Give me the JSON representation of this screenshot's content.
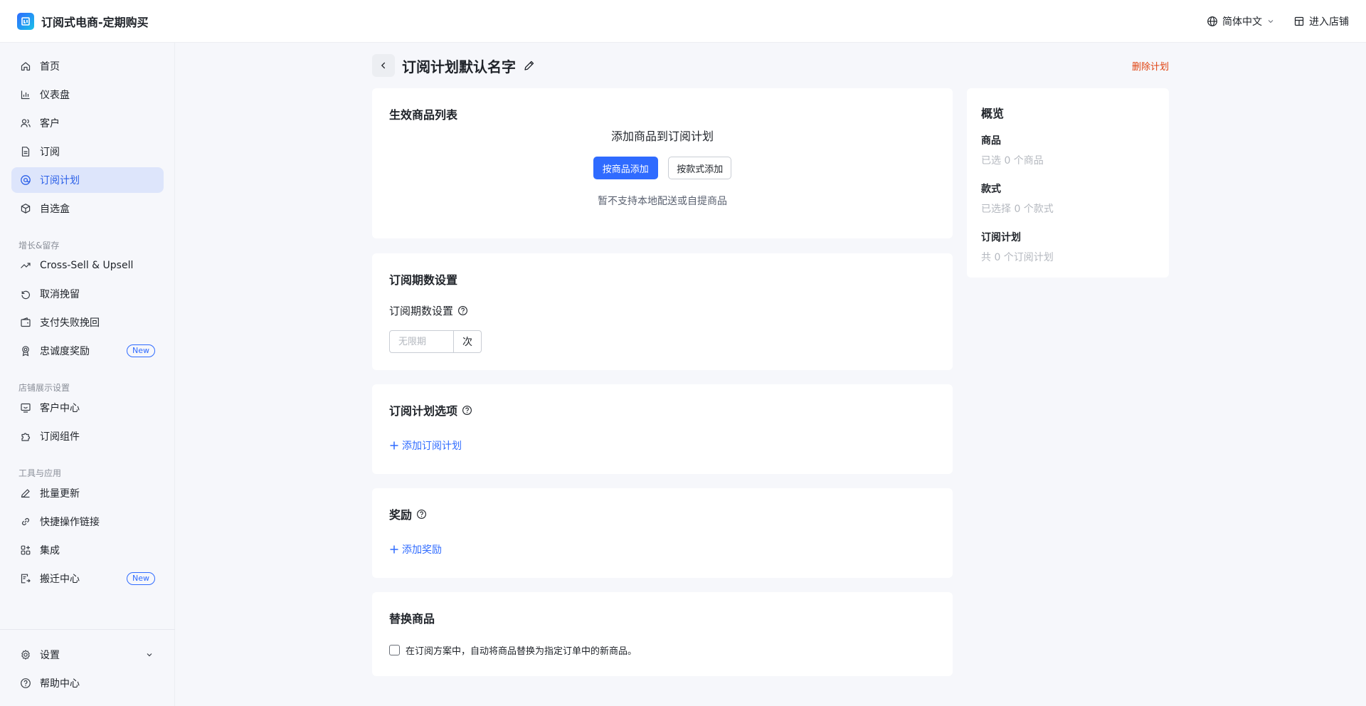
{
  "app": {
    "title": "订阅式电商-定期购买"
  },
  "topbar": {
    "language": "简体中文",
    "enter_store": "进入店铺"
  },
  "sidebar": {
    "items": [
      {
        "label": "首页",
        "icon": "home-icon"
      },
      {
        "label": "仪表盘",
        "icon": "bar-chart-icon"
      },
      {
        "label": "客户",
        "icon": "users-icon"
      },
      {
        "label": "订阅",
        "icon": "document-icon"
      },
      {
        "label": "订阅计划",
        "icon": "plan-icon",
        "active": true
      },
      {
        "label": "自选盒",
        "icon": "box-icon"
      }
    ],
    "groups": [
      {
        "title": "增长&留存",
        "items": [
          {
            "label": "Cross-Sell & Upsell",
            "icon": "trend-up-icon"
          },
          {
            "label": "取消挽留",
            "icon": "undo-icon"
          },
          {
            "label": "支付失败挽回",
            "icon": "wallet-icon"
          },
          {
            "label": "忠诚度奖励",
            "icon": "award-icon",
            "badge": "New"
          }
        ]
      },
      {
        "title": "店铺展示设置",
        "items": [
          {
            "label": "客户中心",
            "icon": "customer-center-icon"
          },
          {
            "label": "订阅组件",
            "icon": "puzzle-icon"
          }
        ]
      },
      {
        "title": "工具与应用",
        "items": [
          {
            "label": "批量更新",
            "icon": "pencil-icon"
          },
          {
            "label": "快捷操作链接",
            "icon": "link-icon"
          },
          {
            "label": "集成",
            "icon": "apps-icon"
          },
          {
            "label": "搬迁中心",
            "icon": "migrate-icon",
            "badge": "New"
          }
        ]
      }
    ],
    "bottom": [
      {
        "label": "设置",
        "icon": "gear-icon"
      },
      {
        "label": "帮助中心",
        "icon": "help-circle-icon"
      }
    ]
  },
  "page": {
    "title": "订阅计划默认名字",
    "delete_label": "删除计划"
  },
  "products_card": {
    "title": "生效商品列表",
    "empty_heading": "添加商品到订阅计划",
    "add_by_product": "按商品添加",
    "add_by_variant": "按款式添加",
    "note": "暂不支持本地配送或自提商品"
  },
  "periods_card": {
    "title": "订阅期数设置",
    "field_label": "订阅期数设置",
    "input_placeholder": "无限期",
    "input_suffix": "次"
  },
  "options_card": {
    "title": "订阅计划选项",
    "add_label": "添加订阅计划"
  },
  "rewards_card": {
    "title": "奖励",
    "add_label": "添加奖励"
  },
  "replace_card": {
    "title": "替换商品",
    "checkbox_label": "在订阅方案中，自动将商品替换为指定订单中的新商品。",
    "checked": false
  },
  "overview": {
    "title": "概览",
    "sections": [
      {
        "label": "商品",
        "value": "已选 0 个商品"
      },
      {
        "label": "款式",
        "value": "已选择 0 个款式"
      },
      {
        "label": "订阅计划",
        "value": "共 0 个订阅计划"
      }
    ]
  },
  "colors": {
    "primary": "#2f6bff",
    "danger": "#e0420f",
    "active_bg": "#dde5fb"
  }
}
